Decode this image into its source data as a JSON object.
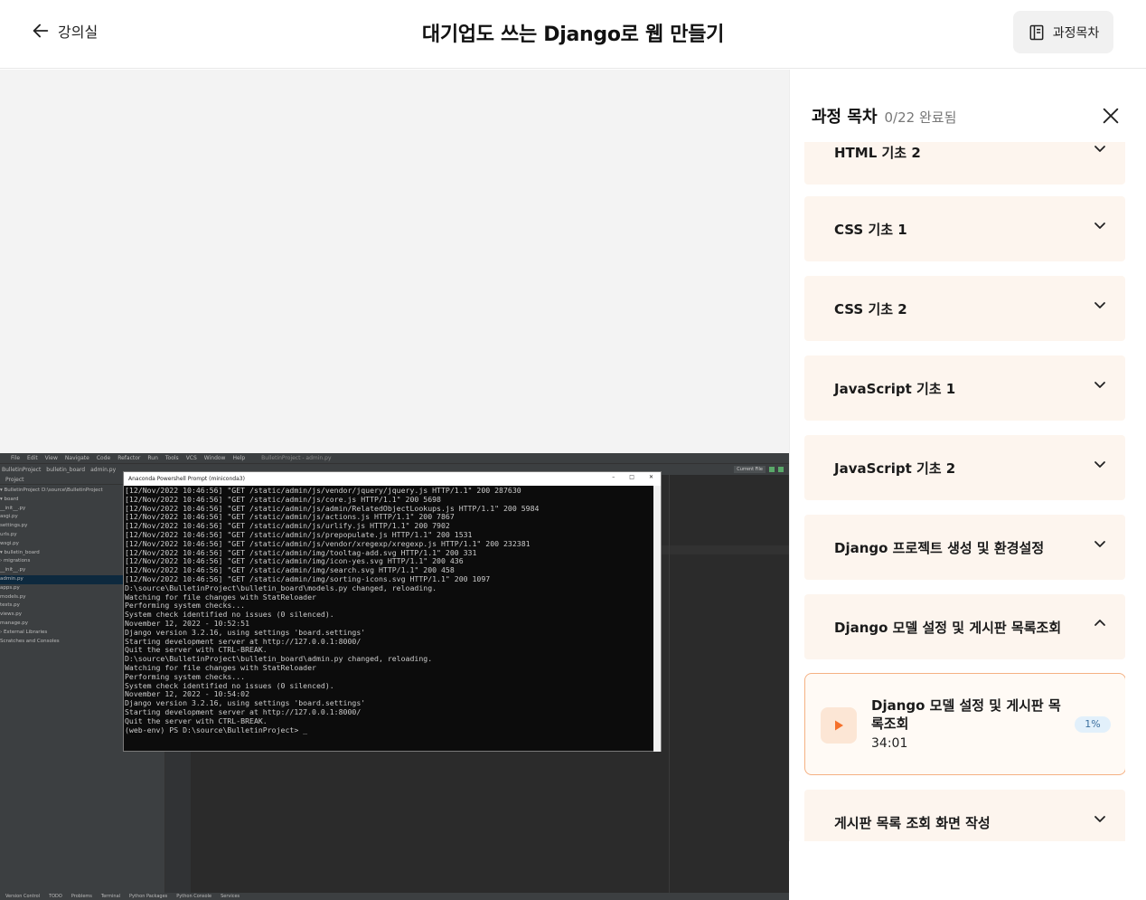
{
  "header": {
    "back_label": "강의실",
    "title": "대기업도 쓰는 Django로 웹 만들기",
    "toc_button_label": "과정목차"
  },
  "sidebar": {
    "title": "과정 목차",
    "completed": "0/22 완료됨",
    "sections": [
      {
        "label": "HTML 기초 2",
        "expanded": false
      },
      {
        "label": "CSS 기초 1",
        "expanded": false
      },
      {
        "label": "CSS 기초 2",
        "expanded": false
      },
      {
        "label": "JavaScript 기초 1",
        "expanded": false
      },
      {
        "label": "JavaScript 기초 2",
        "expanded": false
      },
      {
        "label": "Django 프로젝트 생성 및 환경설정",
        "expanded": false
      },
      {
        "label": "Django 모델 설정 및 게시판 목록조회",
        "expanded": true
      },
      {
        "label": "게시판 목록 조회 화면 작성",
        "expanded": false
      }
    ],
    "current_lesson": {
      "title": "Django 모델 설정 및 게시판 목록조회",
      "duration": "34:01",
      "progress": "1%"
    }
  },
  "video": {
    "ide_menu": [
      "File",
      "Edit",
      "View",
      "Navigate",
      "Code",
      "Refactor",
      "Run",
      "Tools",
      "VCS",
      "Window",
      "Help"
    ],
    "ide_window_title": "BulletinProject - admin.py",
    "ide_breadcrumb": [
      "BulletinProject",
      "bulletin_board",
      "admin.py"
    ],
    "ide_run_config": "Current File",
    "project_header": "Project",
    "project_tree": [
      "▾ BulletinProject  D:\\source\\BulletinProject",
      "  ▾ board",
      "      __init__.py",
      "      asgi.py",
      "      settings.py",
      "      urls.py",
      "      wsgi.py",
      "  ▾ bulletin_board",
      "    › migrations",
      "      __init__.py",
      "      admin.py",
      "      apps.py",
      "      models.py",
      "      tests.py",
      "      views.py",
      "    manage.py",
      "› External Libraries",
      "  Scratches and Consoles"
    ],
    "status_items": [
      "Version Control",
      "TODO",
      "Problems",
      "Terminal",
      "Python Packages",
      "Python Console",
      "Services"
    ],
    "terminal_title": "Anaconda Powershell Prompt (miniconda3)",
    "terminal_lines": [
      "[12/Nov/2022 10:46:56] \"GET /static/admin/js/vendor/jquery/jquery.js HTTP/1.1\" 200 287630",
      "[12/Nov/2022 10:46:56] \"GET /static/admin/js/core.js HTTP/1.1\" 200 5698",
      "[12/Nov/2022 10:46:56] \"GET /static/admin/js/admin/RelatedObjectLookups.js HTTP/1.1\" 200 5984",
      "[12/Nov/2022 10:46:56] \"GET /static/admin/js/actions.js HTTP/1.1\" 200 7867",
      "[12/Nov/2022 10:46:56] \"GET /static/admin/js/urlify.js HTTP/1.1\" 200 7902",
      "[12/Nov/2022 10:46:56] \"GET /static/admin/js/prepopulate.js HTTP/1.1\" 200 1531",
      "[12/Nov/2022 10:46:56] \"GET /static/admin/js/vendor/xregexp/xregexp.js HTTP/1.1\" 200 232381",
      "[12/Nov/2022 10:46:56] \"GET /static/admin/img/tooltag-add.svg HTTP/1.1\" 200 331",
      "[12/Nov/2022 10:46:56] \"GET /static/admin/img/icon-yes.svg HTTP/1.1\" 200 436",
      "[12/Nov/2022 10:46:56] \"GET /static/admin/img/search.svg HTTP/1.1\" 200 458",
      "[12/Nov/2022 10:46:56] \"GET /static/admin/img/sorting-icons.svg HTTP/1.1\" 200 1097",
      "D:\\source\\BulletinProject\\bulletin_board\\models.py changed, reloading.",
      "Watching for file changes with StatReloader",
      "Performing system checks...",
      "",
      "System check identified no issues (0 silenced).",
      "November 12, 2022 - 10:52:51",
      "Django version 3.2.16, using settings 'board.settings'",
      "Starting development server at http://127.0.0.1:8000/",
      "Quit the server with CTRL-BREAK.",
      "D:\\source\\BulletinProject\\bulletin_board\\admin.py changed, reloading.",
      "Watching for file changes with StatReloader",
      "Performing system checks...",
      "",
      "System check identified no issues (0 silenced).",
      "November 12, 2022 - 10:54:02",
      "Django version 3.2.16, using settings 'board.settings'",
      "Starting development server at http://127.0.0.1:8000/",
      "Quit the server with CTRL-BREAK.",
      "(web-env) PS D:\\source\\BulletinProject> _"
    ]
  },
  "colors": {
    "accent": "#f5702a",
    "section_bg": "#fdf5ee",
    "lesson_border": "#f5b183",
    "progress_badge_bg": "#e2f0fb"
  },
  "icons": {
    "back": "arrow-left-icon",
    "toc": "list-panel-icon",
    "close": "close-icon",
    "expand": "chevron-down-icon",
    "collapse": "chevron-up-icon",
    "play": "play-icon"
  }
}
